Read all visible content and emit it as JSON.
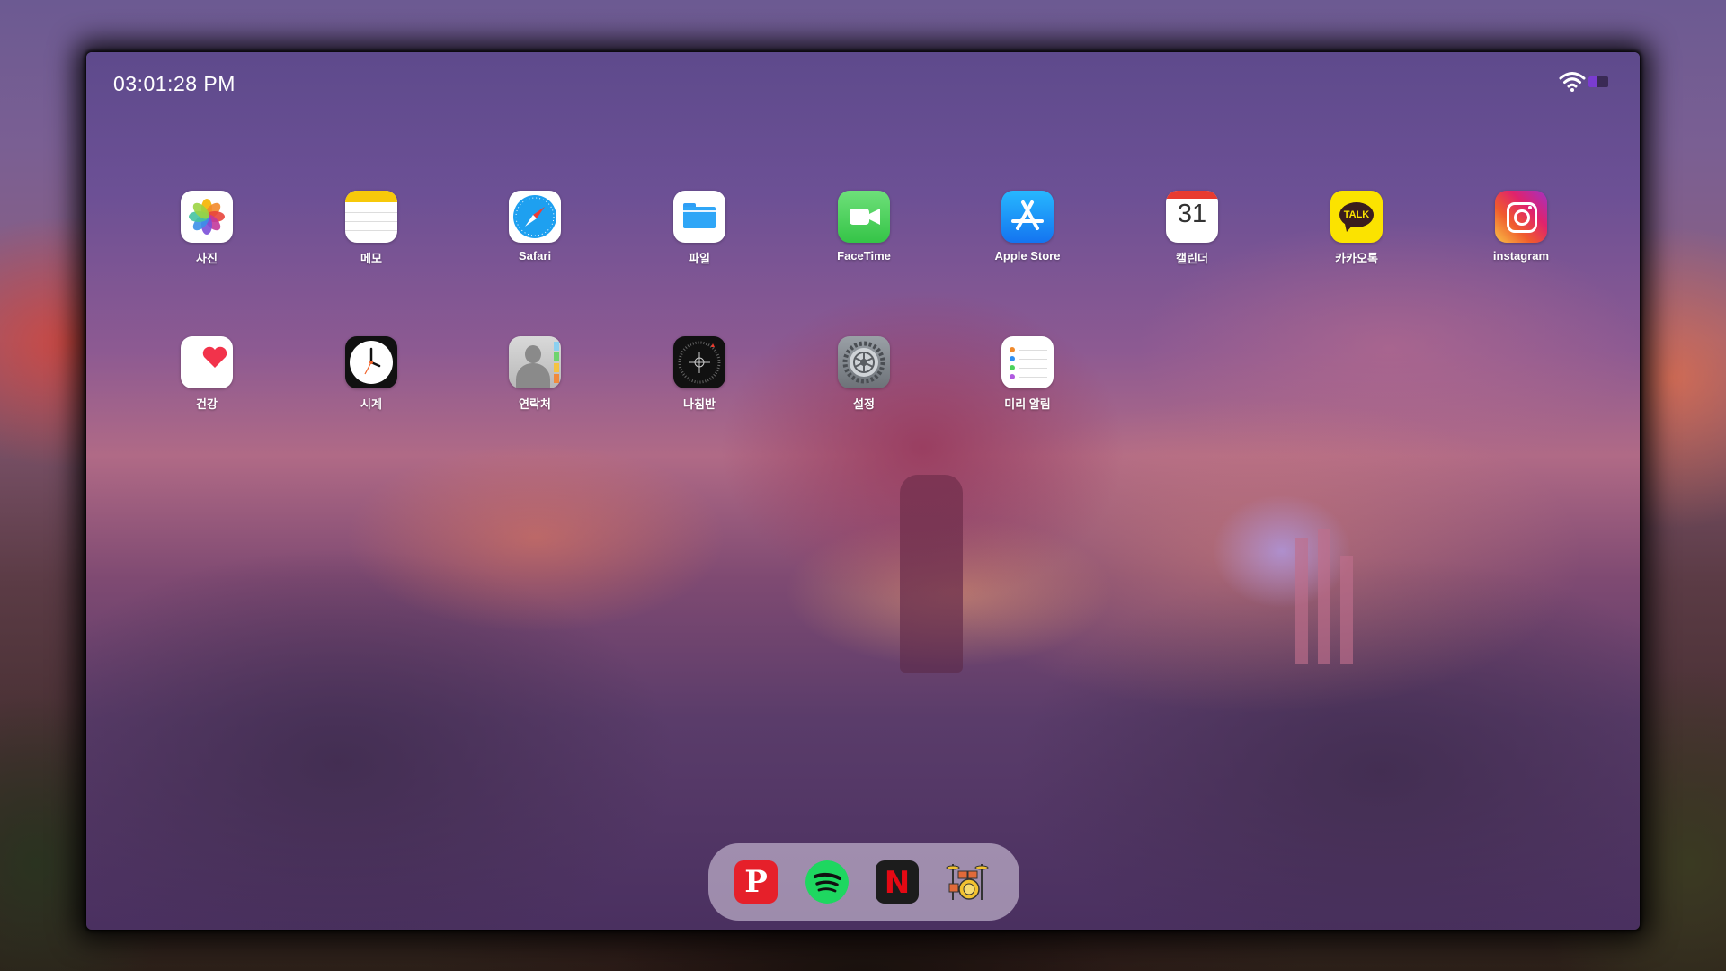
{
  "status_bar": {
    "time": "03:01:28 PM",
    "wifi_icon": "wifi-icon",
    "battery_level": 0.4,
    "battery_color": "#7a3cd0"
  },
  "home_apps": [
    {
      "label": "사진",
      "icon": "photos-icon"
    },
    {
      "label": "메모",
      "icon": "notes-icon"
    },
    {
      "label": "Safari",
      "icon": "safari-icon"
    },
    {
      "label": "파일",
      "icon": "files-icon"
    },
    {
      "label": "FaceTime",
      "icon": "facetime-icon"
    },
    {
      "label": "Apple Store",
      "icon": "app-store-icon"
    },
    {
      "label": "캘린더",
      "icon": "calendar-icon",
      "badge_text": "31"
    },
    {
      "label": "카카오톡",
      "icon": "kakaotalk-icon",
      "badge_text": "TALK"
    },
    {
      "label": "instagram",
      "icon": "instagram-icon"
    },
    {
      "label": "건강",
      "icon": "health-icon"
    },
    {
      "label": "시계",
      "icon": "clock-icon"
    },
    {
      "label": "연락처",
      "icon": "contacts-icon"
    },
    {
      "label": "나침반",
      "icon": "compass-icon"
    },
    {
      "label": "설정",
      "icon": "settings-icon"
    },
    {
      "label": "미리 알림",
      "icon": "reminders-icon"
    }
  ],
  "dock": [
    {
      "icon": "pinterest-icon",
      "glyph": "P"
    },
    {
      "icon": "spotify-icon"
    },
    {
      "icon": "netflix-icon",
      "glyph": "N"
    },
    {
      "icon": "drums-icon"
    }
  ]
}
